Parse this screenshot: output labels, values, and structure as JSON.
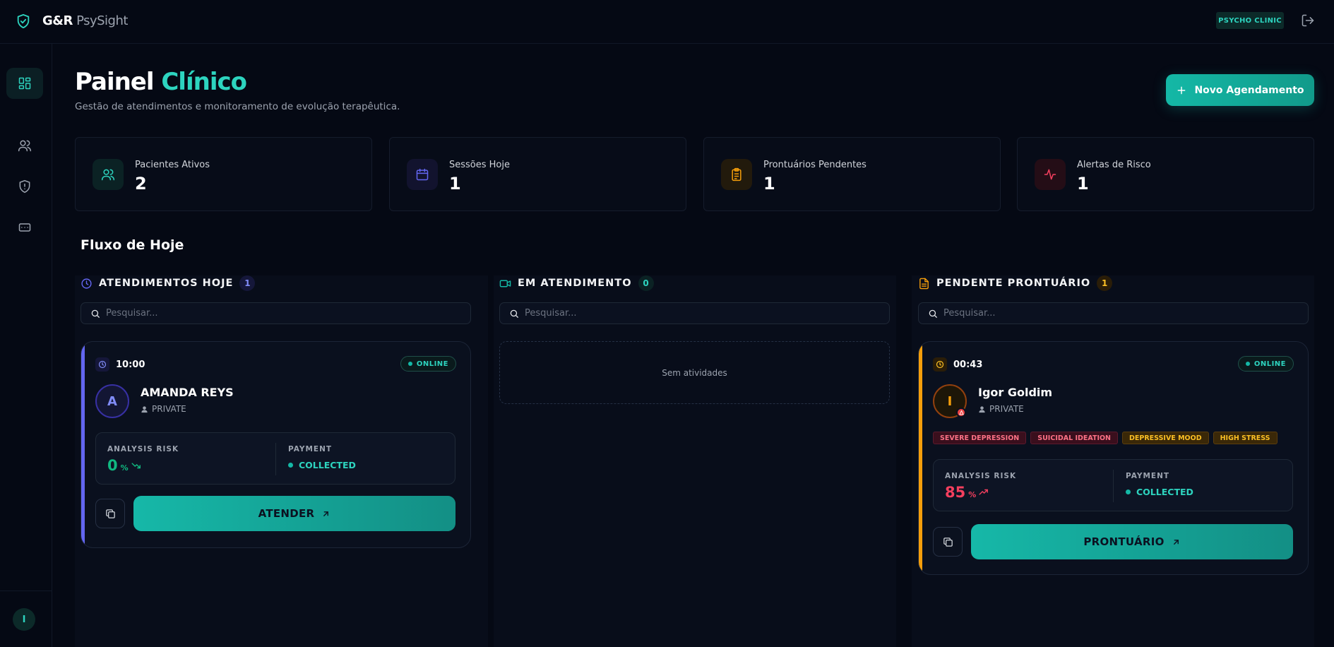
{
  "app": {
    "brand_bold": "G&R",
    "brand_light": " PsySight",
    "clinic_badge": "PSYCHO CLINIC"
  },
  "user": {
    "initial": "I"
  },
  "header": {
    "title_part1": "Painel ",
    "title_part2": "Clínico",
    "subtitle": "Gestão de atendimentos e monitoramento de evolução terapêutica.",
    "new_button_label": "Novo Agendamento"
  },
  "stats": [
    {
      "label": "Pacientes Ativos",
      "value": "2",
      "icon": "users-icon",
      "color": "#2dd4bf"
    },
    {
      "label": "Sessões Hoje",
      "value": "1",
      "icon": "calendar-icon",
      "color": "#6366f1"
    },
    {
      "label": "Prontuários Pendentes",
      "value": "1",
      "icon": "clipboard-icon",
      "color": "#f59e0b"
    },
    {
      "label": "Alertas de Risco",
      "value": "1",
      "icon": "activity-icon",
      "color": "#f43f5e"
    }
  ],
  "flow": {
    "title": "Fluxo de Hoje",
    "search_placeholder": "Pesquisar...",
    "columns": [
      {
        "title": "ATENDIMENTOS HOJE",
        "count": "1",
        "color": "#6366f1"
      },
      {
        "title": "EM ATENDIMENTO",
        "count": "0",
        "color": "#14b8a6"
      },
      {
        "title": "PENDENTE PRONTUÁRIO",
        "count": "1",
        "color": "#f59e0b"
      }
    ],
    "empty_text": "Sem atividades"
  },
  "cards": [
    {
      "time": "10:00",
      "status": "ONLINE",
      "initial": "A",
      "name": "AMANDA REYS",
      "type": "PRIVATE",
      "risk_label": "ANALYSIS RISK",
      "risk_value": "0",
      "risk_unit": "%",
      "payment_label": "PAYMENT",
      "payment_value": "COLLECTED",
      "action_label": "ATENDER",
      "accent": "#6366f1"
    },
    {
      "time": "00:43",
      "status": "ONLINE",
      "initial": "I",
      "name": "Igor Goldim",
      "type": "PRIVATE",
      "tags": [
        "SEVERE DEPRESSION",
        "SUICIDAL IDEATION",
        "DEPRESSIVE MOOD",
        "HIGH STRESS"
      ],
      "risk_label": "ANALYSIS RISK",
      "risk_value": "85",
      "risk_unit": "%",
      "payment_label": "PAYMENT",
      "payment_value": "COLLECTED",
      "action_label": "PRONTUÁRIO",
      "accent": "#f59e0b"
    }
  ]
}
